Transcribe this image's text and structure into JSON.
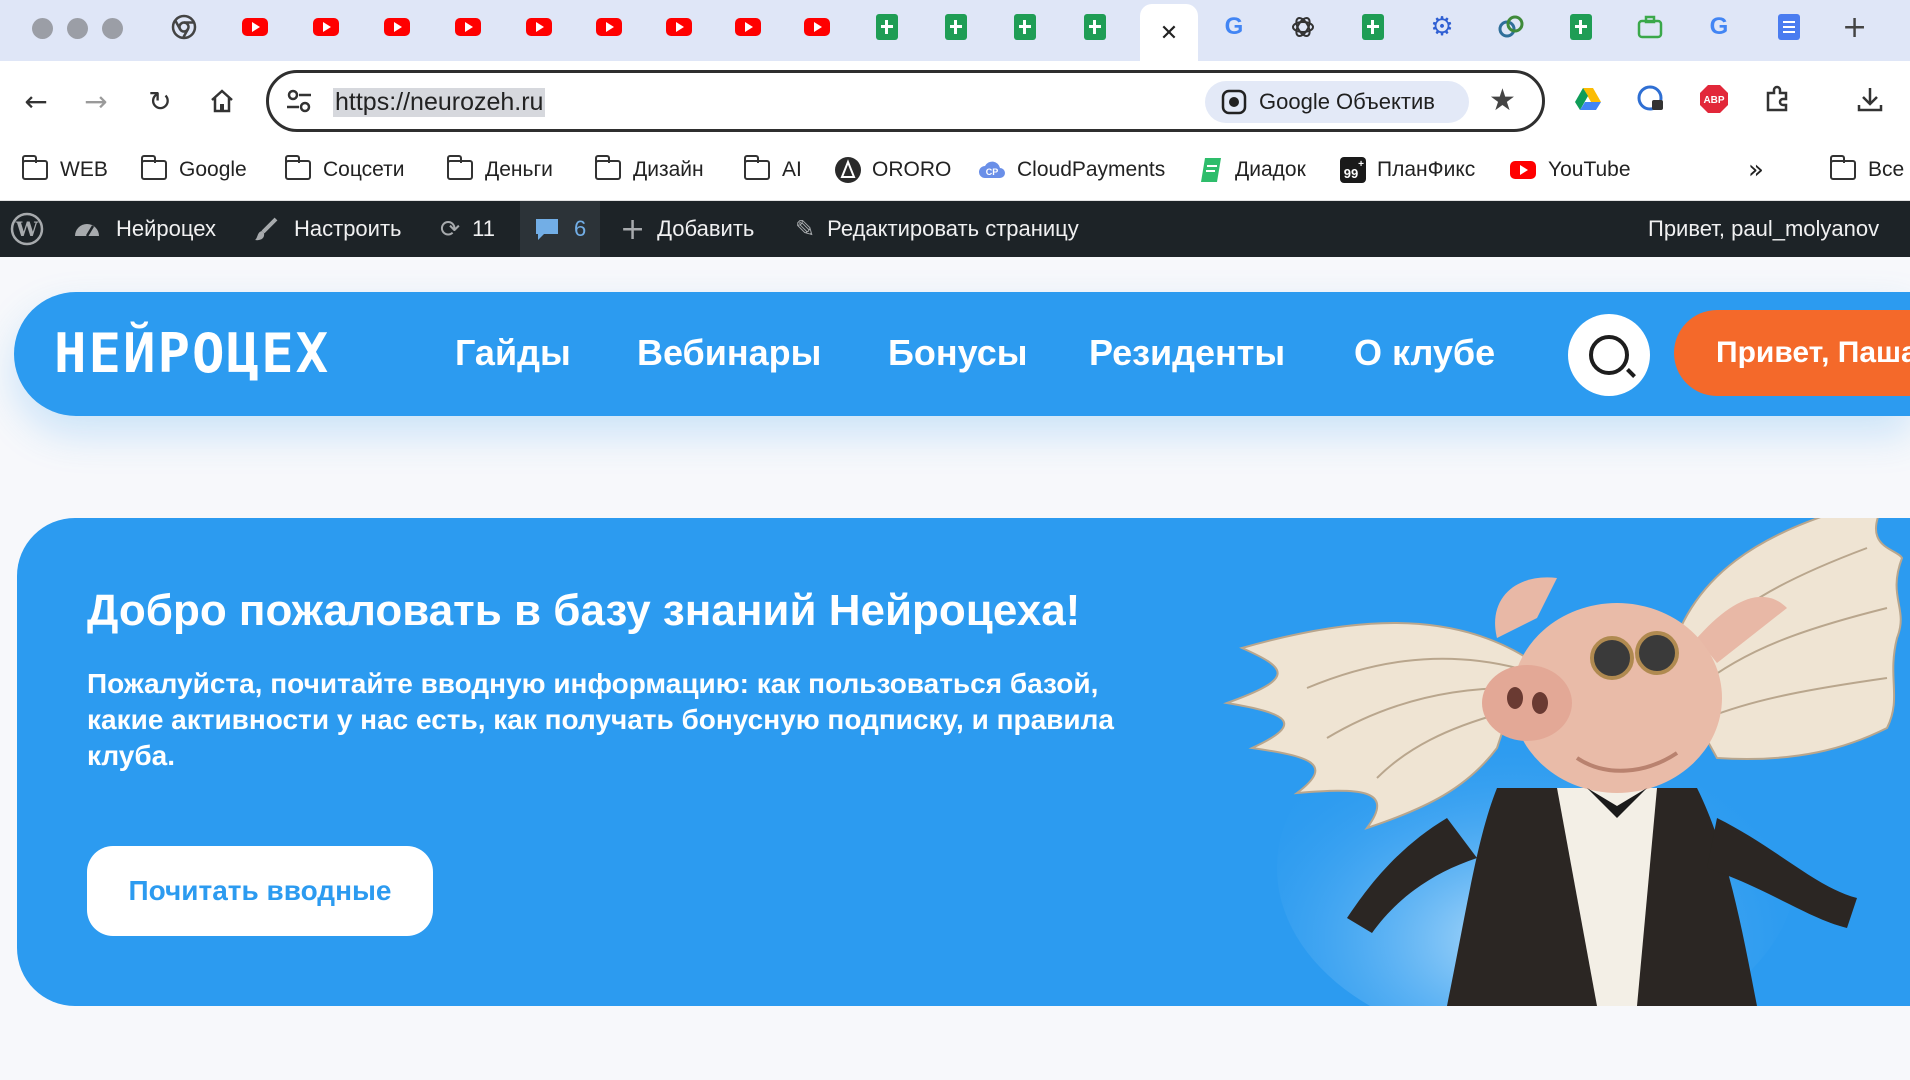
{
  "browser": {
    "tabs": [
      {
        "icon": "chrome-icon"
      },
      {
        "icon": "youtube-icon"
      },
      {
        "icon": "youtube-icon"
      },
      {
        "icon": "youtube-icon"
      },
      {
        "icon": "youtube-icon"
      },
      {
        "icon": "youtube-icon"
      },
      {
        "icon": "youtube-icon"
      },
      {
        "icon": "youtube-icon"
      },
      {
        "icon": "youtube-icon"
      },
      {
        "icon": "youtube-icon"
      },
      {
        "icon": "sheets-icon"
      },
      {
        "icon": "sheets-icon"
      },
      {
        "icon": "sheets-icon"
      },
      {
        "icon": "sheets-icon"
      },
      {
        "icon": "close-icon",
        "active": true
      },
      {
        "icon": "google-icon"
      },
      {
        "icon": "openai-icon"
      },
      {
        "icon": "sheets-icon"
      },
      {
        "icon": "gear-icon"
      },
      {
        "icon": "link-icon"
      },
      {
        "icon": "sheets-icon"
      },
      {
        "icon": "briefcase-icon"
      },
      {
        "icon": "google-icon"
      },
      {
        "icon": "docs-icon"
      }
    ],
    "address": {
      "url": "https://neurozeh.ru",
      "lens_label": "Google Объектив"
    },
    "bookmarks": {
      "items": [
        {
          "label": "WEB",
          "icon": "folder-icon"
        },
        {
          "label": "Google",
          "icon": "folder-icon"
        },
        {
          "label": "Соцсети",
          "icon": "folder-icon"
        },
        {
          "label": "Деньги",
          "icon": "folder-icon"
        },
        {
          "label": "Дизайн",
          "icon": "folder-icon"
        },
        {
          "label": "AI",
          "icon": "folder-icon"
        },
        {
          "label": "ORORO",
          "icon": "ororo-icon"
        },
        {
          "label": "CloudPayments",
          "icon": "cloudpayments-icon"
        },
        {
          "label": "Диадок",
          "icon": "diadoc-icon"
        },
        {
          "label": "ПланФикс",
          "icon": "planfix-icon"
        },
        {
          "label": "YouTube",
          "icon": "youtube-icon"
        }
      ],
      "more": "»",
      "other": "Все"
    }
  },
  "wpbar": {
    "site": "Нейроцех",
    "customize": "Настроить",
    "updates": "11",
    "comments": "6",
    "add": "Добавить",
    "edit": "Редактировать страницу",
    "greeting": "Привет, paul_molyanov"
  },
  "site": {
    "logo": "НЕЙРОЦЕХ",
    "nav": [
      "Гайды",
      "Вебинары",
      "Бонусы",
      "Резиденты",
      "О клубе"
    ],
    "hello": "Привет, Паша"
  },
  "hero": {
    "title": "Добро пожаловать в базу знаний Нейроцеха!",
    "text": "Пожалуйста, почитайте вводную информацию: как пользоваться базой, какие активности у нас есть, как получать бонусную подписку, и правила клуба.",
    "button": "Почитать вводные"
  },
  "colors": {
    "brand_blue": "#2c9bf0",
    "accent_orange": "#f4692a",
    "wp_bar": "#1d2327"
  }
}
